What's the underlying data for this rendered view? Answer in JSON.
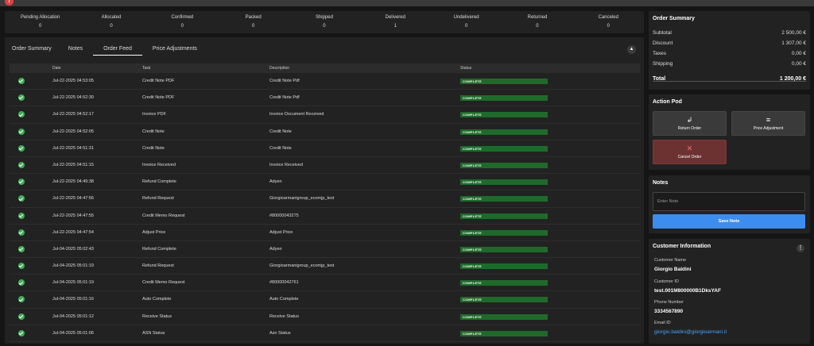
{
  "status_bar": [
    {
      "label": "Pending Allocation",
      "value": "0"
    },
    {
      "label": "Allocated",
      "value": "0"
    },
    {
      "label": "Confirmed",
      "value": "0"
    },
    {
      "label": "Packed",
      "value": "0"
    },
    {
      "label": "Shipped",
      "value": "0"
    },
    {
      "label": "Delivered",
      "value": "1"
    },
    {
      "label": "Undelivered",
      "value": "0"
    },
    {
      "label": "Returned",
      "value": "0"
    },
    {
      "label": "Canceled",
      "value": "0"
    }
  ],
  "tabs": [
    "Order Summary",
    "Notes",
    "Order Feed",
    "Price Adjustments"
  ],
  "active_tab": "Order Feed",
  "feed": {
    "columns": {
      "date": "Date",
      "task": "Task",
      "description": "Description",
      "status": "Status"
    },
    "rows": [
      {
        "date": "Jul-22-2025 04:53:05",
        "task": "Credit Note PDF",
        "description": "Credit Note Pdf",
        "status": "COMPLETE"
      },
      {
        "date": "Jul-22-2025 04:52:30",
        "task": "Credit Note PDF",
        "description": "Credit Note Pdf",
        "status": "COMPLETE"
      },
      {
        "date": "Jul-22-2025 04:52:17",
        "task": "Invoice PDF",
        "description": "Invoice Document Received",
        "status": "COMPLETE"
      },
      {
        "date": "Jul-22-2025 04:52:05",
        "task": "Credit Note",
        "description": "Credit Note",
        "status": "COMPLETE"
      },
      {
        "date": "Jul-22-2025 04:51:31",
        "task": "Credit Note",
        "description": "Credit Note",
        "status": "COMPLETE"
      },
      {
        "date": "Jul-22-2025 04:51:15",
        "task": "Invoice Received",
        "description": "Invoice Received",
        "status": "COMPLETE"
      },
      {
        "date": "Jul-22-2025 04:49:38",
        "task": "Refund Complete",
        "description": "Adyen",
        "status": "COMPLETE"
      },
      {
        "date": "Jul-22-2025 04:47:56",
        "task": "Refund Request",
        "description": "Giorgioarmanigroup_ecomjp_test",
        "status": "COMPLETE"
      },
      {
        "date": "Jul-22-2025 04:47:55",
        "task": "Credit Memo Request",
        "description": "#80000043275",
        "status": "COMPLETE"
      },
      {
        "date": "Jul-22-2025 04:47:54",
        "task": "Adjust Price",
        "description": "Adjust Price",
        "status": "COMPLETE"
      },
      {
        "date": "Jul-04-2025 05:02:43",
        "task": "Refund Complete",
        "description": "Adyen",
        "status": "COMPLETE"
      },
      {
        "date": "Jul-04-2025 05:01:19",
        "task": "Refund Request",
        "description": "Giorgioarmanigroup_ecomjp_test",
        "status": "COMPLETE"
      },
      {
        "date": "Jul-04-2025 05:01:19",
        "task": "Credit Memo Request",
        "description": "#80000042761",
        "status": "COMPLETE"
      },
      {
        "date": "Jul-04-2025 05:01:16",
        "task": "Auto Complete",
        "description": "Auto Complete",
        "status": "COMPLETE"
      },
      {
        "date": "Jul-04-2025 05:01:12",
        "task": "Receive Status",
        "description": "Receive Status",
        "status": "COMPLETE"
      },
      {
        "date": "Jul-04-2025 05:01:06",
        "task": "ASN Status",
        "description": "Asn Status",
        "status": "COMPLETE"
      }
    ]
  },
  "order_summary": {
    "title": "Order Summary",
    "subtotal_label": "Subtotal",
    "subtotal": "2 500,00 €",
    "discount_label": "Discount",
    "discount": "1 307,00 €",
    "taxes_label": "Taxes",
    "taxes": "0,00 €",
    "shipping_label": "Shipping",
    "shipping": "0,00 €",
    "total_label": "Total",
    "total": "1 200,00 €"
  },
  "action_pod": {
    "title": "Action Pod",
    "return_label": "Return Order",
    "price_adjustment_label": "Price Adjustment",
    "cancel_label": "Cancel Order"
  },
  "notes": {
    "title": "Notes",
    "placeholder": "Enter Note",
    "save_label": "Save Note"
  },
  "customer": {
    "title": "Customer Information",
    "name_label": "Customer Name",
    "name": "Giorgio Baldini",
    "id_label": "Customer ID",
    "id": "test.001M800000B1DksYAF",
    "phone_label": "Phone Number",
    "phone": "3334567890",
    "email_label": "Email ID",
    "email": "giorgio.baldini@giorgioarmani.it"
  },
  "colors": {
    "complete_badge": "#1f6a2b",
    "check": "#3fae57",
    "primary": "#3b8ef0",
    "danger": "#6c3232",
    "link": "#4aa3ff"
  },
  "icons": {
    "check": "check-circle-icon",
    "collapse": "chevron-up-icon",
    "return": "return-arrow-icon",
    "adjust": "sliders-icon",
    "cancel": "close-icon",
    "more": "more-vertical-icon"
  }
}
